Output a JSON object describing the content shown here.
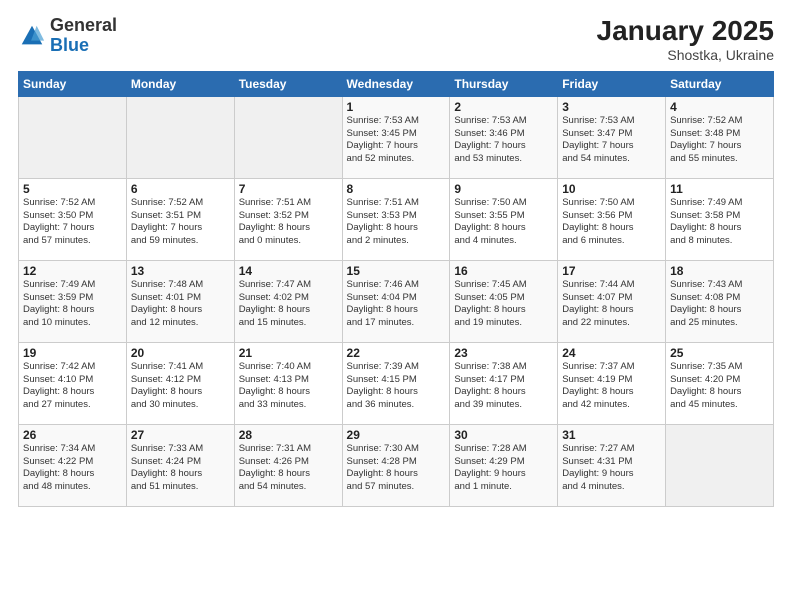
{
  "logo": {
    "general": "General",
    "blue": "Blue"
  },
  "header": {
    "title": "January 2025",
    "location": "Shostka, Ukraine"
  },
  "weekdays": [
    "Sunday",
    "Monday",
    "Tuesday",
    "Wednesday",
    "Thursday",
    "Friday",
    "Saturday"
  ],
  "weeks": [
    [
      {
        "day": "",
        "info": ""
      },
      {
        "day": "",
        "info": ""
      },
      {
        "day": "",
        "info": ""
      },
      {
        "day": "1",
        "info": "Sunrise: 7:53 AM\nSunset: 3:45 PM\nDaylight: 7 hours\nand 52 minutes."
      },
      {
        "day": "2",
        "info": "Sunrise: 7:53 AM\nSunset: 3:46 PM\nDaylight: 7 hours\nand 53 minutes."
      },
      {
        "day": "3",
        "info": "Sunrise: 7:53 AM\nSunset: 3:47 PM\nDaylight: 7 hours\nand 54 minutes."
      },
      {
        "day": "4",
        "info": "Sunrise: 7:52 AM\nSunset: 3:48 PM\nDaylight: 7 hours\nand 55 minutes."
      }
    ],
    [
      {
        "day": "5",
        "info": "Sunrise: 7:52 AM\nSunset: 3:50 PM\nDaylight: 7 hours\nand 57 minutes."
      },
      {
        "day": "6",
        "info": "Sunrise: 7:52 AM\nSunset: 3:51 PM\nDaylight: 7 hours\nand 59 minutes."
      },
      {
        "day": "7",
        "info": "Sunrise: 7:51 AM\nSunset: 3:52 PM\nDaylight: 8 hours\nand 0 minutes."
      },
      {
        "day": "8",
        "info": "Sunrise: 7:51 AM\nSunset: 3:53 PM\nDaylight: 8 hours\nand 2 minutes."
      },
      {
        "day": "9",
        "info": "Sunrise: 7:50 AM\nSunset: 3:55 PM\nDaylight: 8 hours\nand 4 minutes."
      },
      {
        "day": "10",
        "info": "Sunrise: 7:50 AM\nSunset: 3:56 PM\nDaylight: 8 hours\nand 6 minutes."
      },
      {
        "day": "11",
        "info": "Sunrise: 7:49 AM\nSunset: 3:58 PM\nDaylight: 8 hours\nand 8 minutes."
      }
    ],
    [
      {
        "day": "12",
        "info": "Sunrise: 7:49 AM\nSunset: 3:59 PM\nDaylight: 8 hours\nand 10 minutes."
      },
      {
        "day": "13",
        "info": "Sunrise: 7:48 AM\nSunset: 4:01 PM\nDaylight: 8 hours\nand 12 minutes."
      },
      {
        "day": "14",
        "info": "Sunrise: 7:47 AM\nSunset: 4:02 PM\nDaylight: 8 hours\nand 15 minutes."
      },
      {
        "day": "15",
        "info": "Sunrise: 7:46 AM\nSunset: 4:04 PM\nDaylight: 8 hours\nand 17 minutes."
      },
      {
        "day": "16",
        "info": "Sunrise: 7:45 AM\nSunset: 4:05 PM\nDaylight: 8 hours\nand 19 minutes."
      },
      {
        "day": "17",
        "info": "Sunrise: 7:44 AM\nSunset: 4:07 PM\nDaylight: 8 hours\nand 22 minutes."
      },
      {
        "day": "18",
        "info": "Sunrise: 7:43 AM\nSunset: 4:08 PM\nDaylight: 8 hours\nand 25 minutes."
      }
    ],
    [
      {
        "day": "19",
        "info": "Sunrise: 7:42 AM\nSunset: 4:10 PM\nDaylight: 8 hours\nand 27 minutes."
      },
      {
        "day": "20",
        "info": "Sunrise: 7:41 AM\nSunset: 4:12 PM\nDaylight: 8 hours\nand 30 minutes."
      },
      {
        "day": "21",
        "info": "Sunrise: 7:40 AM\nSunset: 4:13 PM\nDaylight: 8 hours\nand 33 minutes."
      },
      {
        "day": "22",
        "info": "Sunrise: 7:39 AM\nSunset: 4:15 PM\nDaylight: 8 hours\nand 36 minutes."
      },
      {
        "day": "23",
        "info": "Sunrise: 7:38 AM\nSunset: 4:17 PM\nDaylight: 8 hours\nand 39 minutes."
      },
      {
        "day": "24",
        "info": "Sunrise: 7:37 AM\nSunset: 4:19 PM\nDaylight: 8 hours\nand 42 minutes."
      },
      {
        "day": "25",
        "info": "Sunrise: 7:35 AM\nSunset: 4:20 PM\nDaylight: 8 hours\nand 45 minutes."
      }
    ],
    [
      {
        "day": "26",
        "info": "Sunrise: 7:34 AM\nSunset: 4:22 PM\nDaylight: 8 hours\nand 48 minutes."
      },
      {
        "day": "27",
        "info": "Sunrise: 7:33 AM\nSunset: 4:24 PM\nDaylight: 8 hours\nand 51 minutes."
      },
      {
        "day": "28",
        "info": "Sunrise: 7:31 AM\nSunset: 4:26 PM\nDaylight: 8 hours\nand 54 minutes."
      },
      {
        "day": "29",
        "info": "Sunrise: 7:30 AM\nSunset: 4:28 PM\nDaylight: 8 hours\nand 57 minutes."
      },
      {
        "day": "30",
        "info": "Sunrise: 7:28 AM\nSunset: 4:29 PM\nDaylight: 9 hours\nand 1 minute."
      },
      {
        "day": "31",
        "info": "Sunrise: 7:27 AM\nSunset: 4:31 PM\nDaylight: 9 hours\nand 4 minutes."
      },
      {
        "day": "",
        "info": ""
      }
    ]
  ]
}
